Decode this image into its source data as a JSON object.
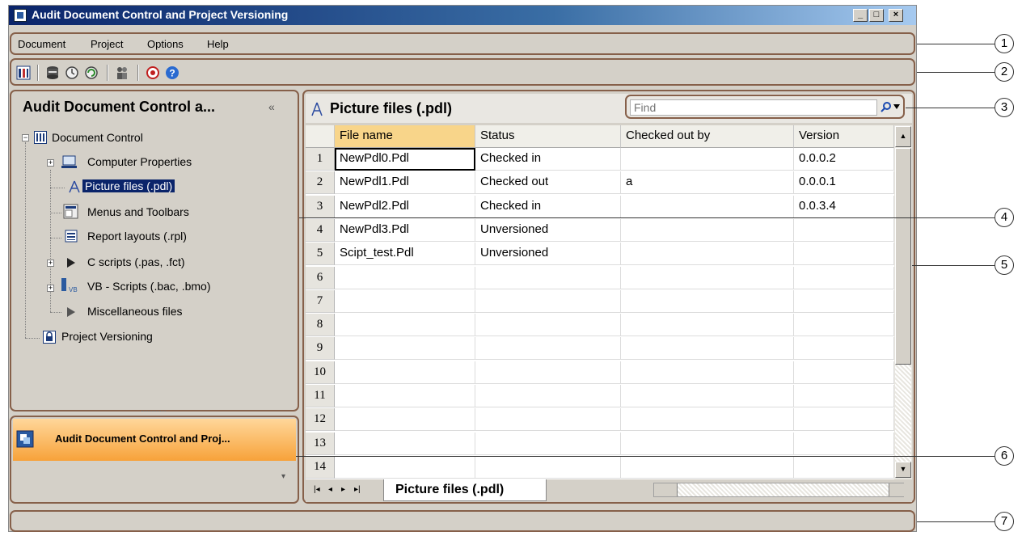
{
  "window": {
    "title": "Audit Document Control and Project Versioning",
    "caption_min": "_",
    "caption_max": "□",
    "caption_close": "×"
  },
  "menu": [
    "Document",
    "Project",
    "Options",
    "Help"
  ],
  "toolbar": {
    "icons": [
      "document-control-icon",
      "database-icon",
      "checkin-icon",
      "refresh-icon",
      "users-icon",
      "target-icon",
      "help-icon"
    ]
  },
  "navigation": {
    "title": "Audit Document Control a...",
    "collapse": "«",
    "tree": [
      {
        "label": "Document Control",
        "icon": "document-control-icon"
      },
      {
        "label": "Computer Properties",
        "icon": "computer-icon"
      },
      {
        "label": "Picture files (.pdl)",
        "icon": "compass-icon",
        "selected": true
      },
      {
        "label": "Menus and Toolbars",
        "icon": "menu-icon"
      },
      {
        "label": "Report layouts (.rpl)",
        "icon": "report-icon"
      },
      {
        "label": "C scripts (.pas, .fct)",
        "icon": "play-icon"
      },
      {
        "label": "VB - Scripts (.bac, .bmo)",
        "icon": "vb-script-icon"
      },
      {
        "label": "Miscellaneous files",
        "icon": "play-icon"
      },
      {
        "label": "Project Versioning",
        "icon": "lock-icon"
      }
    ],
    "nav_button": "Audit Document Control and Proj...",
    "nav_chevron": "▾"
  },
  "main": {
    "title": "Picture files (.pdl)",
    "find_placeholder": "Find",
    "columns": [
      "File name",
      "Status",
      "Checked out by",
      "Version"
    ],
    "row_numbers": [
      "1",
      "2",
      "3",
      "4",
      "5",
      "6",
      "7",
      "8",
      "9",
      "10",
      "11",
      "12",
      "13",
      "14"
    ],
    "rows": [
      [
        "NewPdl0.Pdl",
        "Checked in",
        "",
        "0.0.0.2"
      ],
      [
        "NewPdl1.Pdl",
        "Checked out",
        "a",
        "0.0.0.1"
      ],
      [
        "NewPdl2.Pdl",
        "Checked in",
        "",
        "0.0.3.4"
      ],
      [
        "NewPdl3.Pdl",
        "Unversioned",
        "",
        ""
      ],
      [
        "Scipt_test.Pdl",
        "Unversioned",
        "",
        ""
      ]
    ],
    "sheet_tab": "Picture files (.pdl)",
    "sheet_nav": [
      "|◂",
      "◂",
      "▸",
      "▸|"
    ]
  },
  "callouts": [
    "1",
    "2",
    "3",
    "4",
    "5",
    "6",
    "7"
  ],
  "colors": {
    "frame": "#86604a",
    "title_bar": "#0a246a",
    "nav_button": "#f7a23a",
    "selected": "#0a246a"
  }
}
